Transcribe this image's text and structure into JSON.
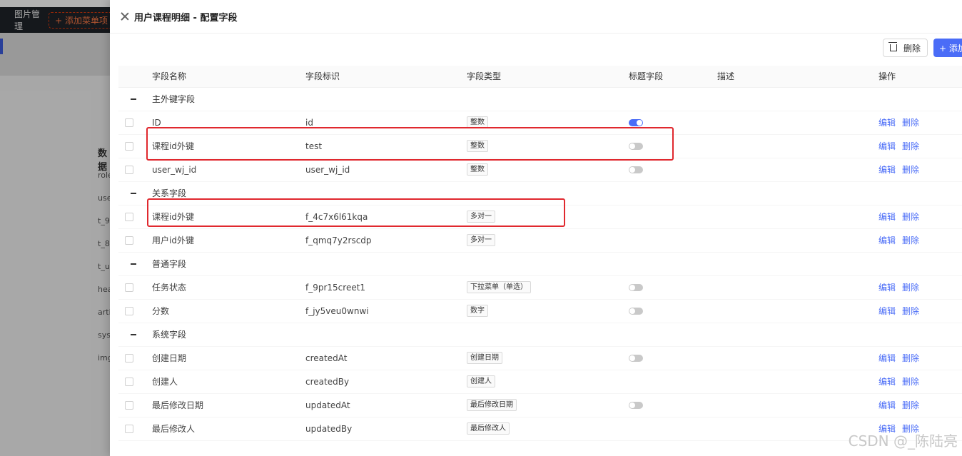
{
  "background": {
    "nav_items": [
      "图片管理"
    ],
    "add_menu_label": "+ 添加菜单项",
    "section_title": "数据",
    "list_items": [
      "role",
      "use",
      "t_9",
      "t_8",
      "t_u",
      "hea",
      "arti",
      "sys",
      "img"
    ]
  },
  "drawer": {
    "title": "用户课程明细 - 配置字段",
    "toolbar": {
      "delete_label": "删除",
      "add_label": "+ 添加"
    }
  },
  "table": {
    "headers": {
      "name": "字段名称",
      "key": "字段标识",
      "type": "字段类型",
      "title_field": "标题字段",
      "desc": "描述",
      "ops": "操作"
    },
    "actions": {
      "edit": "编辑",
      "delete": "删除"
    },
    "groups": [
      {
        "label": "主外键字段",
        "rows": [
          {
            "name": "ID",
            "key": "id",
            "type": "整数",
            "title_switch": "on"
          },
          {
            "name": "课程id外键",
            "key": "test",
            "type": "整数",
            "title_switch": "off"
          },
          {
            "name": "user_wj_id",
            "key": "user_wj_id",
            "type": "整数",
            "title_switch": "off"
          }
        ]
      },
      {
        "label": "关系字段",
        "rows": [
          {
            "name": "课程id外键",
            "key": "f_4c7x6l61kqa",
            "type": "多对一",
            "title_switch": "none"
          },
          {
            "name": "用户id外键",
            "key": "f_qmq7y2rscdp",
            "type": "多对一",
            "title_switch": "none"
          }
        ]
      },
      {
        "label": "普通字段",
        "rows": [
          {
            "name": "任务状态",
            "key": "f_9pr15creet1",
            "type": "下拉菜单（单选）",
            "title_switch": "off"
          },
          {
            "name": "分数",
            "key": "f_jy5veu0wnwi",
            "type": "数字",
            "title_switch": "off"
          }
        ]
      },
      {
        "label": "系统字段",
        "rows": [
          {
            "name": "创建日期",
            "key": "createdAt",
            "type": "创建日期",
            "title_switch": "off"
          },
          {
            "name": "创建人",
            "key": "createdBy",
            "type": "创建人",
            "title_switch": "none"
          },
          {
            "name": "最后修改日期",
            "key": "updatedAt",
            "type": "最后修改日期",
            "title_switch": "off"
          },
          {
            "name": "最后修改人",
            "key": "updatedBy",
            "type": "最后修改人",
            "title_switch": "none"
          }
        ]
      }
    ]
  },
  "watermark": "CSDN @_陈陆亮",
  "colors": {
    "primary": "#4a6cf7",
    "highlight": "#e0282e"
  }
}
